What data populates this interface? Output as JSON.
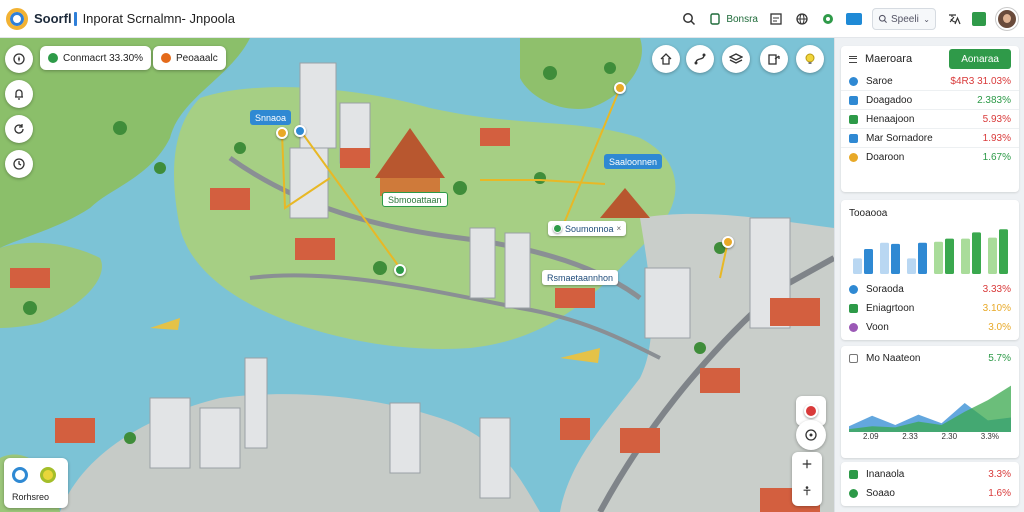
{
  "app": {
    "brand": "Soorfl",
    "title": "Inporat Scrnalmn- Jnpoola"
  },
  "topbar": {
    "link_label": "Bonsra",
    "search_placeholder": "Speeli",
    "icons": [
      "search-icon",
      "bookmark-icon",
      "list-icon",
      "globe-icon",
      "settings-icon",
      "translate-icon",
      "tag-icon"
    ]
  },
  "map": {
    "chips": [
      {
        "label": "Conmacrt 33.30%",
        "color": "#2d9a48"
      },
      {
        "label": "Peoaaalc",
        "color": "#e46a1a"
      }
    ],
    "labels": [
      {
        "text": "Snnaoa",
        "style": "blue"
      },
      {
        "text": "Sbmooattaan",
        "style": "green"
      },
      {
        "text": "Soumonnoa",
        "style": "white"
      },
      {
        "text": "Saaloonnen",
        "style": "blue"
      },
      {
        "text": "Rsmaetaannhon",
        "style": "white"
      }
    ],
    "left_controls": [
      "compass-icon",
      "bell-icon",
      "refresh-icon",
      "history-icon"
    ],
    "top_controls": [
      "home-icon",
      "route-icon",
      "layers-icon",
      "share-icon",
      "lightbulb-icon"
    ],
    "bottom_card_label": "Rorhsreo"
  },
  "panel": {
    "header": {
      "title": "Maeroara",
      "button": "Aonaraa"
    },
    "kpis": [
      {
        "label": "Saroe",
        "value": "$4R3 31.03%",
        "color": "#d93a3a",
        "icon_color": "#2f89d3"
      },
      {
        "label": "Doagadoo",
        "value": "2.383%",
        "color": "#2d9a48",
        "icon_color": "#2f89d3"
      },
      {
        "label": "Henaajoon",
        "value": "5.93%",
        "color": "#d93a3a",
        "icon_color": "#2d9a48"
      },
      {
        "label": "Mar Sornadore",
        "value": "1.93%",
        "color": "#d93a3a",
        "icon_color": "#2f89d3"
      },
      {
        "label": "Doaroon",
        "value": "1.67%",
        "color": "#2d9a48",
        "icon_color": "#e8a928"
      }
    ],
    "bar_section_title": "Tooaooa",
    "legend_rows": [
      {
        "label": "Soraoda",
        "value": "3.33%",
        "color": "#d93a3a",
        "icon_color": "#2f89d3"
      },
      {
        "label": "Eniagrtoon",
        "value": "3.10%",
        "color": "#e8a928",
        "icon_color": "#2d9a48"
      },
      {
        "label": "Voon",
        "value": "3.0%",
        "color": "#e8a928",
        "icon_color": "#9b59b6"
      }
    ],
    "line_section": {
      "title": "Mo Naateon",
      "value": "5.7%",
      "value_color": "#2d9a48"
    },
    "footer_rows": [
      {
        "label": "Inanaola",
        "value": "3.3%",
        "color": "#d93a3a",
        "icon_color": "#2d9a48"
      },
      {
        "label": "Soaao",
        "value": "1.6%",
        "color": "#d93a3a",
        "icon_color": "#2d9a48"
      }
    ]
  },
  "chart_data": [
    {
      "type": "bar",
      "title": "Tooaooa",
      "series": [
        {
          "values": [
            0.3,
            0.6,
            0.3,
            0.62,
            0.68,
            0.7
          ]
        },
        {
          "values": [
            0.48,
            0.58,
            0.6,
            0.68,
            0.8,
            0.86
          ]
        }
      ],
      "series_colors": [
        "#b9d7f2",
        "#2f89d3",
        "#a9dc9a",
        "#3aa84e"
      ]
    },
    {
      "type": "area",
      "title": "Mo Naateon",
      "x_tick_labels": [
        "2.09",
        "2.33",
        "2.30",
        "3.3%"
      ],
      "series": [
        {
          "color": "#2f89d3",
          "values": [
            0.1,
            0.28,
            0.12,
            0.3,
            0.15,
            0.5,
            0.2,
            0.25
          ]
        },
        {
          "color": "#3aa84e",
          "values": [
            0.05,
            0.1,
            0.08,
            0.18,
            0.12,
            0.35,
            0.55,
            0.8
          ]
        }
      ]
    }
  ]
}
